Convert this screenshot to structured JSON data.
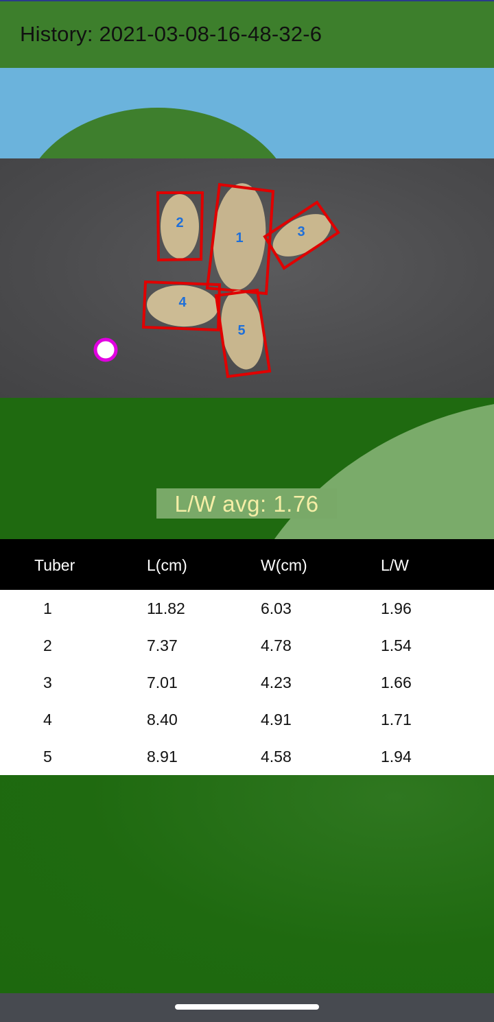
{
  "header": {
    "title": "History: 2021-03-08-16-48-32-6"
  },
  "summary": {
    "lw_average": "L/W avg:  1.76"
  },
  "tubers_image": {
    "labels": [
      "1",
      "2",
      "3",
      "4",
      "5"
    ]
  },
  "table": {
    "columns": [
      "Tuber",
      "L(cm)",
      "W(cm)",
      "L/W"
    ],
    "rows": [
      [
        "1",
        "11.82",
        "6.03",
        "1.96"
      ],
      [
        "2",
        "7.37",
        "4.78",
        "1.54"
      ],
      [
        "3",
        "7.01",
        "4.23",
        "1.66"
      ],
      [
        "4",
        "8.40",
        "4.91",
        "1.71"
      ],
      [
        "5",
        "8.91",
        "4.58",
        "1.94"
      ]
    ]
  },
  "colors": {
    "app_bar": "#3d7f2c",
    "box_outline": "#e00000",
    "tuber_label": "#1e6fd9",
    "marker_ring": "#e000e0",
    "badge_bg": "#79a968",
    "badge_text": "#f5eea6"
  },
  "icons": {
    "marker": "circle-marker-icon",
    "nav_handle": "gesture-handle-icon"
  }
}
